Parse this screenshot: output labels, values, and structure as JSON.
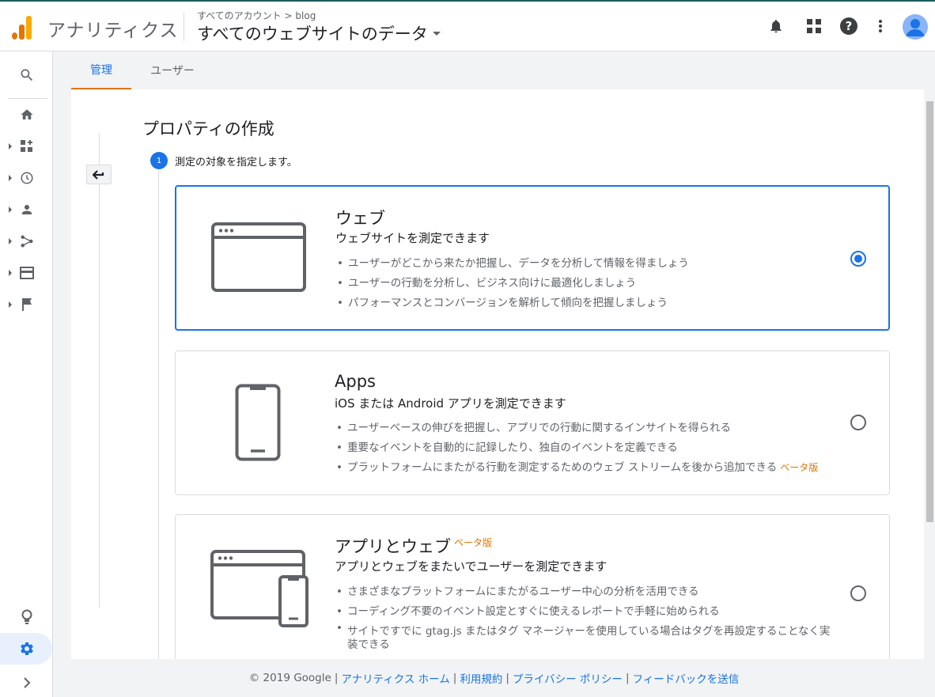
{
  "header": {
    "app_name": "アナリティクス",
    "breadcrumb_account": "すべてのアカウント",
    "breadcrumb_sep": ">",
    "breadcrumb_property": "blog",
    "property_selector": "すべてのウェブサイトのデータ"
  },
  "tabs": [
    {
      "label": "管理"
    },
    {
      "label": "ユーザー"
    }
  ],
  "page": {
    "title": "プロパティの作成",
    "step_number": "1",
    "step_label": "測定の対象を指定します。"
  },
  "options": [
    {
      "title": "ウェブ",
      "subtitle": "ウェブサイトを測定できます",
      "bullets": [
        "ユーザーがどこから来たか把握し、データを分析して情報を得ましょう",
        "ユーザーの行動を分析し、ビジネス向けに最適化しましょう",
        "パフォーマンスとコンバージョンを解析して傾向を把握しましょう"
      ],
      "selected": true
    },
    {
      "title": "Apps",
      "subtitle": "iOS または Android アプリを測定できます",
      "bullets": [
        "ユーザーベースの伸びを把握し、アプリでの行動に関するインサイトを得られる",
        "重要なイベントを自動的に記録したり、独自のイベントを定義できる",
        "プラットフォームにまたがる行動を測定するためのウェブ ストリームを後から追加できる"
      ],
      "beta_label": "ベータ版",
      "selected": false
    },
    {
      "title": "アプリとウェブ",
      "beta_label": "ベータ版",
      "subtitle": "アプリとウェブをまたいでユーザーを測定できます",
      "bullets": [
        "さまざまなプラットフォームにまたがるユーザー中心の分析を活用できる",
        "コーディング不要のイベント設定とすぐに使えるレポートで手軽に始められる",
        "サイトですでに gtag.js またはタグ マネージャーを使用している場合はタグを再設定することなく実装できる"
      ],
      "selected": false
    }
  ],
  "footer": {
    "copyright": "© 2019 Google",
    "sep": "|",
    "links": [
      "アナリティクス ホーム",
      "利用規約",
      "プライバシー ポリシー",
      "フィードバックを送信"
    ]
  },
  "colors": {
    "accent": "#1a73e8",
    "tab_underline": "#e37400",
    "beta": "#e37400",
    "logo_orange": "#f9ab00",
    "logo_dark": "#e37400"
  },
  "icons": {
    "logo": "analytics-logo",
    "notifications": "bell-icon",
    "apps": "apps-grid-icon",
    "help": "help-icon",
    "more": "more-vert-icon",
    "account": "account-avatar",
    "nav": [
      "search-icon",
      "home-icon",
      "customization-icon",
      "realtime-clock-icon",
      "audience-person-icon",
      "acquisition-icon",
      "behavior-icon",
      "conversions-flag-icon",
      "discover-lightbulb-icon",
      "admin-gear-icon",
      "expand-chevron-icon"
    ]
  }
}
